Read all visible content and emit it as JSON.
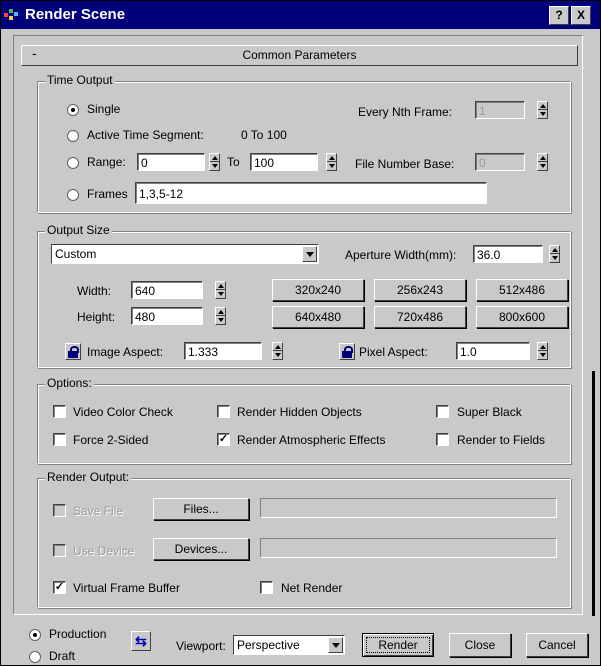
{
  "window": {
    "title": "Render Scene",
    "help": "?",
    "close": "X"
  },
  "rollout": {
    "title": "Common Parameters",
    "toggle": "-"
  },
  "time_output": {
    "label": "Time Output",
    "single": "Single",
    "active_segment": "Active Time Segment:",
    "active_range": "0 To 100",
    "range": "Range:",
    "range_from": "0",
    "range_to_label": "To",
    "range_to": "100",
    "frames": "Frames",
    "frames_value": "1,3,5-12",
    "every_nth_label": "Every Nth Frame:",
    "every_nth_value": "1",
    "file_number_base_label": "File Number Base:",
    "file_number_base_value": "0",
    "selected": "single"
  },
  "output_size": {
    "label": "Output Size",
    "preset": "Custom",
    "aperture_label": "Aperture Width(mm):",
    "aperture_value": "36.0",
    "width_label": "Width:",
    "width_value": "640",
    "height_label": "Height:",
    "height_value": "480",
    "presets": [
      "320x240",
      "256x243",
      "512x486",
      "640x480",
      "720x486",
      "800x600"
    ],
    "image_aspect_label": "Image Aspect:",
    "image_aspect_value": "1.333",
    "pixel_aspect_label": "Pixel Aspect:",
    "pixel_aspect_value": "1.0"
  },
  "options": {
    "label": "Options:",
    "video_color_check": "Video Color Check",
    "render_hidden": "Render Hidden Objects",
    "super_black": "Super Black",
    "force_2_sided": "Force 2-Sided",
    "render_atmospheric": "Render Atmospheric Effects",
    "render_to_fields": "Render to Fields",
    "checkmark": "✓"
  },
  "render_output": {
    "label": "Render Output:",
    "save_file": "Save File",
    "files_button": "Files...",
    "use_device": "Use Device",
    "devices_button": "Devices...",
    "virtual_frame_buffer": "Virtual Frame Buffer",
    "net_render": "Net Render"
  },
  "footer": {
    "production": "Production",
    "draft": "Draft",
    "swap_glyph": "⇆",
    "viewport_label": "Viewport:",
    "viewport_value": "Perspective",
    "render_button": "Render",
    "close_button": "Close",
    "cancel_button": "Cancel"
  },
  "colors": {
    "titlebar": "#00007b",
    "face": "#c9c9c9",
    "lock": "#00007b"
  }
}
